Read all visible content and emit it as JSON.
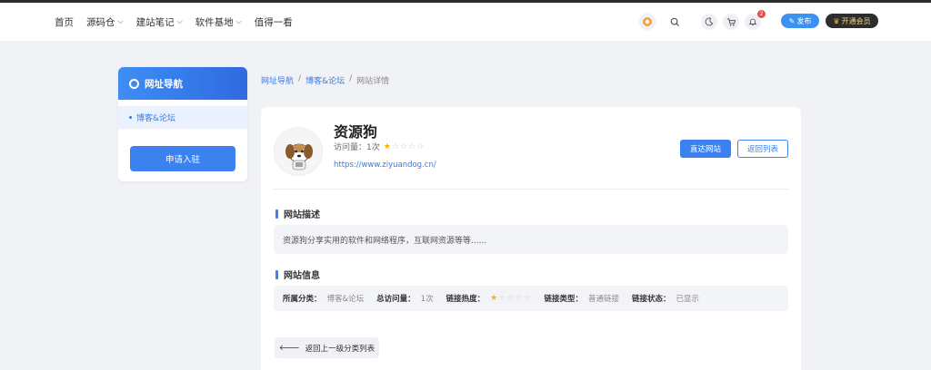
{
  "nav": {
    "items": [
      {
        "label": "首页",
        "dropdown": false
      },
      {
        "label": "源码仓",
        "dropdown": true
      },
      {
        "label": "建站笔记",
        "dropdown": true
      },
      {
        "label": "软件基地",
        "dropdown": true
      },
      {
        "label": "值得一看",
        "dropdown": false
      }
    ]
  },
  "header": {
    "notification_count": "2",
    "publish_label": "发布",
    "vip_label": "开通会员"
  },
  "sidebar": {
    "title": "网址导航",
    "items": [
      {
        "label": "博客&论坛",
        "active": true
      }
    ],
    "apply_label": "申请入驻"
  },
  "breadcrumb": {
    "items": [
      "网址导航",
      "博客&论坛",
      "网站详情"
    ],
    "separator": "/"
  },
  "site": {
    "name": "资源狗",
    "visits_label": "访问量：1次",
    "rating": 1,
    "rating_max": 5,
    "url": "https://www.ziyuandog.cn/",
    "go_label": "直达网站",
    "back_label": "返回列表"
  },
  "description": {
    "title": "网站描述",
    "text": "资源狗分享实用的软件和网络程序，互联网资源等等......"
  },
  "info": {
    "title": "网站信息",
    "category_key": "所属分类：",
    "category_val": "博客&论坛",
    "visits_key": "总访问量：",
    "visits_val": "1次",
    "heat_key": "链接热度：",
    "type_key": "链接类型：",
    "type_val": "普通链接",
    "status_key": "链接状态：",
    "status_val": "已显示"
  },
  "back_up_label": "返回上一级分类列表",
  "colors": {
    "accent": "#3b82f0",
    "star": "#f7b500",
    "badge": "#f04b4b"
  }
}
